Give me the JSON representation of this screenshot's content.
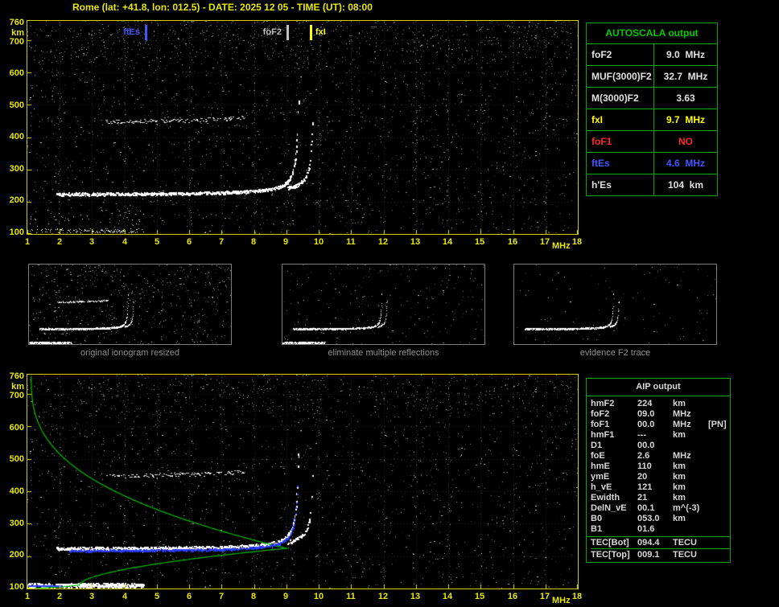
{
  "title": "Rome (lat: +41.8, lon: 012.5) - DATE: 2025 12 05 - TIME (UT): 08:00",
  "colors": {
    "axis_yellow": "#e8e800",
    "plot_border_yellow": "#cfcf00",
    "table_border_green": "#00aa00",
    "table_title_green": "#00cc00",
    "profile_green": "#00c000",
    "restored_blue": "#2a3cff",
    "warning_red": "#ff2a2a",
    "es_blue": "#4455ff"
  },
  "axes": {
    "y_ticks": [
      760,
      700,
      600,
      500,
      400,
      300,
      200,
      100
    ],
    "y_unit": "km",
    "x_ticks": [
      "1",
      "2",
      "3",
      "4",
      "5",
      "6",
      "7",
      "8",
      "9",
      "10",
      "11",
      "12",
      "13",
      "14",
      "15",
      "16",
      "17",
      "18"
    ],
    "x_unit": "MHz"
  },
  "top_plot": {
    "markers": [
      {
        "label": "ftEs",
        "freq_mhz": 4.6,
        "color": "#4455ff",
        "side": "left"
      },
      {
        "label": "foF2",
        "freq_mhz": 9.0,
        "color": "#c0c0c0",
        "side": "left"
      },
      {
        "label": "fxI",
        "freq_mhz": 9.7,
        "color": "#ffff00",
        "side": "right"
      }
    ]
  },
  "autoscala_table": {
    "title": "AUTOSCALA output",
    "rows": [
      {
        "label": "foF2",
        "value": "9.0  MHz",
        "color": "#e0e0e0"
      },
      {
        "label": "MUF(3000)F2",
        "value": "32.7  MHz",
        "color": "#e0e0e0"
      },
      {
        "label": "M(3000)F2",
        "value": "3.63",
        "color": "#e0e0e0"
      },
      {
        "label": "fxI",
        "value": "9.7  MHz",
        "color": "#ffff00"
      },
      {
        "label": "foF1",
        "value": "NO",
        "color": "#ff2a2a"
      },
      {
        "label": "ftEs",
        "value": "4.6  MHz",
        "color": "#4455ff"
      },
      {
        "label": "h'Es",
        "value": "104  km",
        "color": "#e0e0e0"
      }
    ]
  },
  "thumbnails": [
    {
      "caption": "original ionogram resized"
    },
    {
      "caption": "eliminate multiple reflections"
    },
    {
      "caption": "evidence F2 trace"
    }
  ],
  "aip_table": {
    "title": "AIP output",
    "rows": [
      {
        "label": "hmF2",
        "value": "224",
        "unit": "km"
      },
      {
        "label": "foF2",
        "value": "09.0",
        "unit": "MHz"
      },
      {
        "label": "foF1",
        "value": "00.0",
        "unit": "MHz",
        "extra": "[PN]"
      },
      {
        "label": "hmF1",
        "value": "---",
        "unit": "km"
      },
      {
        "label": "D1",
        "value": "00.0",
        "unit": ""
      },
      {
        "label": "foE",
        "value": "2.6",
        "unit": "MHz"
      },
      {
        "label": "hmE",
        "value": "110",
        "unit": "km"
      },
      {
        "label": "ymE",
        "value": "20",
        "unit": "km"
      },
      {
        "label": "h_vE",
        "value": "121",
        "unit": "km"
      },
      {
        "label": "Ewidth",
        "value": "21",
        "unit": "km"
      },
      {
        "label": "DelN_vE",
        "value": "00.1",
        "unit": "m^(-3)"
      },
      {
        "label": "B0",
        "value": "053.0",
        "unit": "km"
      },
      {
        "label": "B1",
        "value": "01.6",
        "unit": ""
      }
    ],
    "tec_rows": [
      {
        "label": "TEC[Bot]",
        "value": "094.4",
        "unit": "TECU"
      },
      {
        "label": "TEC[Top]",
        "value": "009.1",
        "unit": "TECU"
      }
    ]
  },
  "chart_data": [
    {
      "type": "scatter",
      "title": "autoscaled ionogram (top panel)",
      "xlabel": "MHz",
      "ylabel": "km",
      "xlim": [
        1,
        18
      ],
      "ylim": [
        100,
        760
      ],
      "series": [
        {
          "name": "F2 o-mode trace",
          "summary": "virtual height ~224 km from ~2 to 9 MHz, asymptotic cusp at foF2 = 9.0 MHz rising to ~500 km"
        },
        {
          "name": "x-mode trace",
          "summary": "cusp asymptote at fxI = 9.7 MHz"
        },
        {
          "name": "second-hop multiple",
          "summary": "~450-510 km between ~3.5 and 7.7 MHz"
        },
        {
          "name": "sporadic E trace",
          "summary": "~104 km from 1 to 4.6 MHz (ftEs = 4.6 MHz, h'Es = 104 km)"
        }
      ],
      "markers": [
        {
          "label": "ftEs",
          "x": 4.6
        },
        {
          "label": "foF2",
          "x": 9.0
        },
        {
          "label": "fxI",
          "x": 9.7
        }
      ]
    },
    {
      "type": "line",
      "title": "AIP electron density profile (bottom panel, green curve over same ionogram)",
      "xlabel": "MHz",
      "ylabel": "km",
      "xlim": [
        1,
        18
      ],
      "ylim": [
        100,
        760
      ],
      "key_points": {
        "hmF2_km": 224,
        "foF2_MHz": 9.0,
        "hmE_km": 110,
        "foE_MHz": 2.6
      },
      "overlays": [
        {
          "name": "restored F trace",
          "color": "blue"
        },
        {
          "name": "Es trace marker",
          "color": "blue",
          "location": "bottom-left ~100 km, 1-2 MHz"
        }
      ]
    }
  ]
}
